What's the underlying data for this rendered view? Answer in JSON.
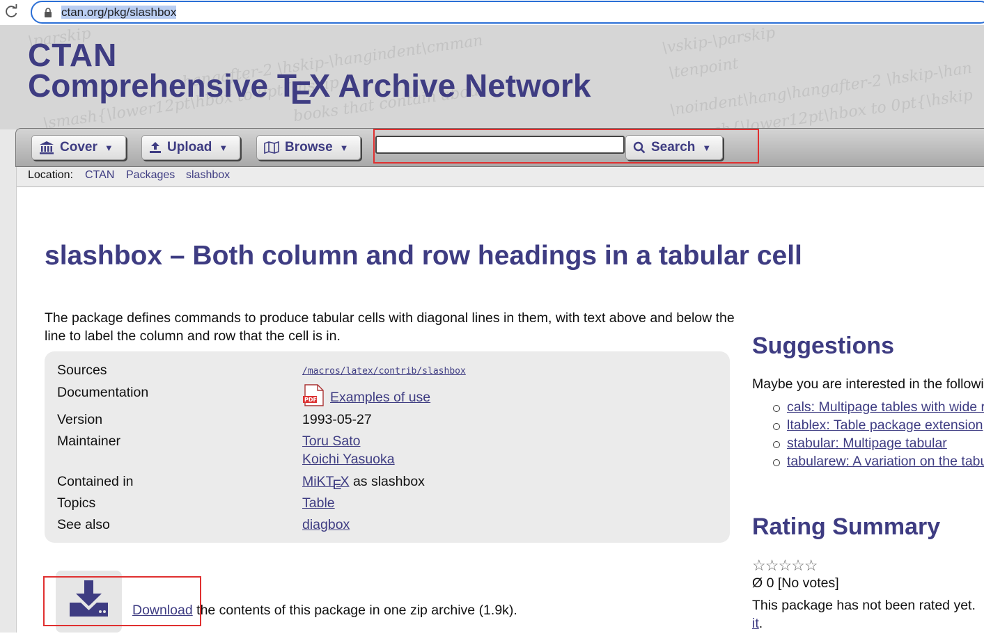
{
  "browser": {
    "url": "ctan.org/pkg/slashbox"
  },
  "header": {
    "brand_short": "CTAN",
    "brand_long_pre": "Comprehensive T",
    "brand_long_e": "E",
    "brand_long_post": "X Archive Network"
  },
  "nav": {
    "cover_label": "Cover",
    "upload_label": "Upload",
    "browse_label": "Browse",
    "search_label": "Search",
    "search_value": ""
  },
  "location": {
    "label": "Location:",
    "crumbs": [
      "CTAN",
      "Packages",
      "slashbox"
    ]
  },
  "package": {
    "title": "slashbox – Both column and row headings in a tabular cell",
    "description": "The package defines commands to produce tabular cells with diagonal lines in them, with text above and below the line to label the column and row that the cell is in.",
    "rows": {
      "sources_label": "Sources",
      "sources_value": "/macros/latex/contrib/slashbox",
      "documentation_label": "Documentation",
      "documentation_value": "Examples of use",
      "version_label": "Version",
      "version_value": "1993-05-27",
      "maintainer_label": "Maintainer",
      "maintainers": [
        "Toru Sato",
        "Koichi Yasuoka"
      ],
      "contained_label": "Contained in",
      "contained_link_pre": "MiKT",
      "contained_link_e": "E",
      "contained_link_post": "X",
      "contained_suffix": " as slashbox",
      "topics_label": "Topics",
      "topics_value": "Table",
      "seealso_label": "See also",
      "seealso_value": "diagbox"
    }
  },
  "download": {
    "link": "Download",
    "text": " the contents of this package in one zip archive (1.9k)."
  },
  "suggestions": {
    "heading": "Suggestions",
    "intro": "Maybe you are interested in the followi",
    "items": [
      "cals: Multipage tables with wide r",
      "ltablex: Table package extension",
      "stabular: Multipage tabular",
      "tabularew: A variation on the tabu"
    ]
  },
  "rating": {
    "heading": "Rating Summary",
    "stars": "☆☆☆☆☆",
    "votes": "Ø 0 [No votes]",
    "not_rated": "This package has not been rated yet.",
    "tail_link": "it",
    "tail_text": "."
  },
  "colors": {
    "brand": "#3e3c82",
    "highlight": "#e03030"
  }
}
